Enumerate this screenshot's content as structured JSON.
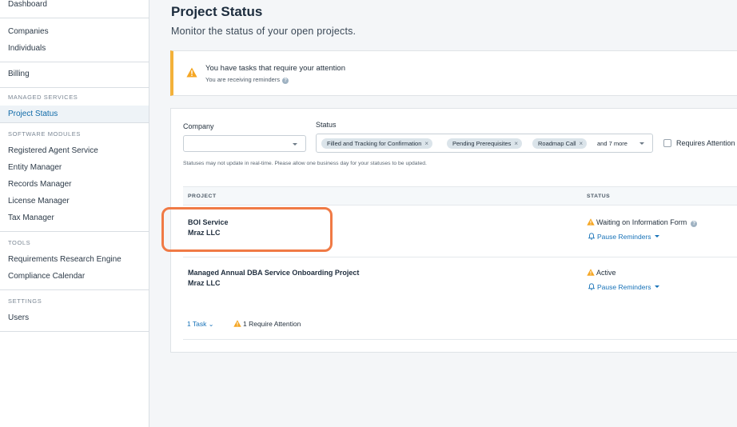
{
  "sidebar": {
    "groups": [
      {
        "heading": "",
        "items": [
          {
            "label": "Dashboard"
          }
        ]
      },
      {
        "heading": "",
        "items": [
          {
            "label": "Companies"
          },
          {
            "label": "Individuals"
          }
        ]
      },
      {
        "heading": "",
        "items": [
          {
            "label": "Billing"
          }
        ]
      },
      {
        "heading": "MANAGED SERVICES",
        "items": [
          {
            "label": "Project Status",
            "active": true
          }
        ]
      },
      {
        "heading": "SOFTWARE MODULES",
        "items": [
          {
            "label": "Registered Agent Service"
          },
          {
            "label": "Entity Manager"
          },
          {
            "label": "Records Manager"
          },
          {
            "label": "License Manager"
          },
          {
            "label": "Tax Manager"
          }
        ]
      },
      {
        "heading": "TOOLS",
        "items": [
          {
            "label": "Requirements Research Engine"
          },
          {
            "label": "Compliance Calendar"
          }
        ]
      },
      {
        "heading": "SETTINGS",
        "items": [
          {
            "label": "Users"
          }
        ]
      }
    ]
  },
  "header": {
    "title": "Project Status",
    "subtitle": "Monitor the status of your open projects."
  },
  "alert": {
    "title": "You have tasks that require your attention",
    "subtitle": "You are receiving reminders",
    "icon": "warning-icon",
    "accent_color": "#f3b13a"
  },
  "filters": {
    "company_label": "Company",
    "company_value": "",
    "status_label": "Status",
    "status_chips": [
      {
        "label": "Filled and Tracking for Confirmation"
      },
      {
        "label": "Pending Prerequisites"
      },
      {
        "label": "Roadmap Call"
      }
    ],
    "status_more": "and 7 more",
    "requires_attention_label": "Requires Attention",
    "note": "Statuses may not update in real-time. Please allow one business day for your statuses to be updated."
  },
  "table": {
    "columns": {
      "project": "PROJECT",
      "status": "STATUS"
    },
    "rows": [
      {
        "name": "BOI Service",
        "company": "Mraz LLC",
        "status": "Waiting on Information Form",
        "action": "Pause Reminders"
      },
      {
        "name": "Managed Annual DBA Service Onboarding Project",
        "company": "Mraz LLC",
        "status": "Active",
        "action": "Pause Reminders"
      }
    ],
    "tasks_link": "1 Task",
    "attention_text": "1 Require Attention"
  },
  "colors": {
    "link": "#1772b8",
    "warning": "#f5a623",
    "highlight": "#f07a45"
  }
}
